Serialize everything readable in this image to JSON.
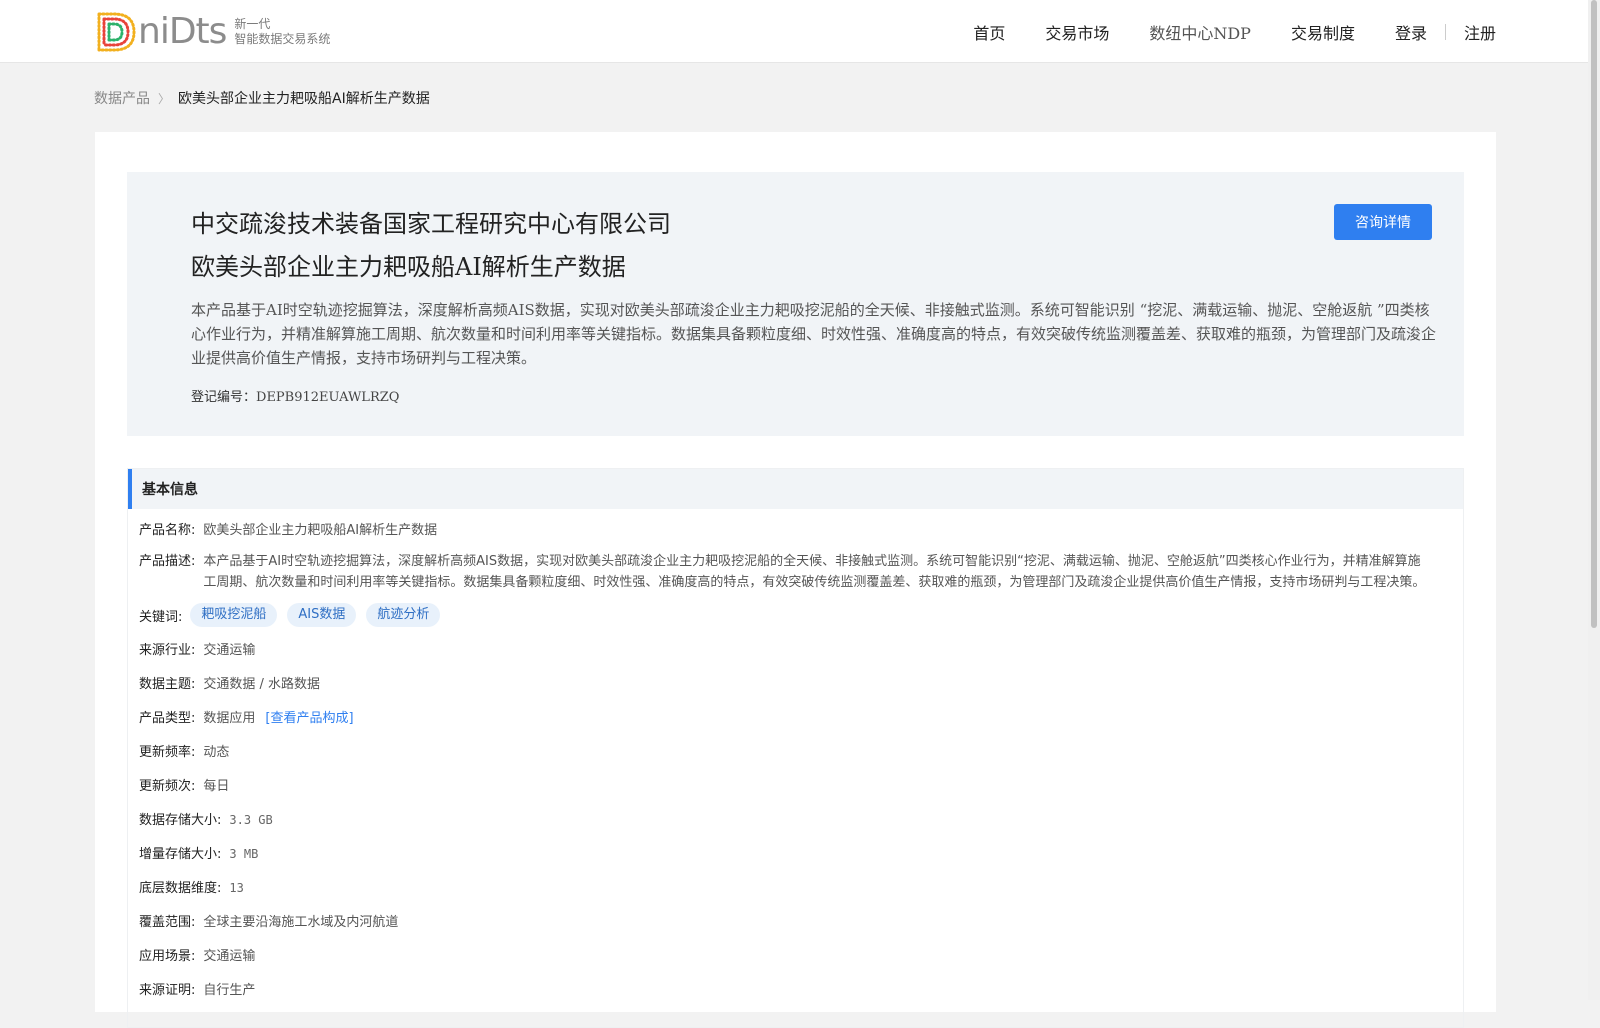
{
  "header": {
    "logo_word": "niDts",
    "logo_tag_line1": "新一代",
    "logo_tag_line2": "智能数据交易系统",
    "nav": [
      "首页",
      "交易市场",
      "数纽中心NDP",
      "交易制度"
    ],
    "login": "登录",
    "register": "注册"
  },
  "breadcrumb": {
    "parent": "数据产品",
    "current": "欧美头部企业主力耙吸船AI解析生产数据"
  },
  "hero": {
    "company": "中交疏浚技术装备国家工程研究中心有限公司",
    "title": "欧美头部企业主力耙吸船AI解析生产数据",
    "description": "本产品基于AI时空轨迹挖掘算法，深度解析高频AIS数据，实现对欧美头部疏浚企业主力耙吸挖泥船的全天候、非接触式监测。系统可智能识别 “挖泥、满载运输、抛泥、空舱返航 ”四类核心作业行为，并精准解算施工周期、航次数量和时间利用率等关键指标。数据集具备颗粒度细、时效性强、准确度高的特点，有效突破传统监测覆盖差、获取难的瓶颈，为管理部门及疏浚企业提供高价值生产情报，支持市场研判与工程决策。",
    "reg_label": "登记编号：",
    "reg_code": "DEPB912EUAWLRZQ",
    "consult_button": "咨询详情"
  },
  "basic_info": {
    "title": "基本信息",
    "product_name_label": "产品名称:",
    "product_name": "欧美头部企业主力耙吸船AI解析生产数据",
    "desc_label": "产品描述:",
    "desc": "本产品基于AI时空轨迹挖掘算法，深度解析高频AIS数据，实现对欧美头部疏浚企业主力耙吸挖泥船的全天候、非接触式监测。系统可智能识别“挖泥、满载运输、抛泥、空舱返航”四类核心作业行为，并精准解算施工周期、航次数量和时间利用率等关键指标。数据集具备颗粒度细、时效性强、准确度高的特点，有效突破传统监测覆盖差、获取难的瓶颈，为管理部门及疏浚企业提供高价值生产情报，支持市场研判与工程决策。",
    "keywords_label": "关键词:",
    "keywords": [
      "耙吸挖泥船",
      "AIS数据",
      "航迹分析"
    ],
    "industry_label": "来源行业:",
    "industry": "交通运输",
    "theme_label": "数据主题:",
    "theme": "交通数据 / 水路数据",
    "type_label": "产品类型:",
    "type": "数据应用",
    "type_link": "[查看产品构成]",
    "freq_label": "更新频率:",
    "freq": "动态",
    "cadence_label": "更新频次:",
    "cadence": "每日",
    "storage_label": "数据存储大小:",
    "storage": "3.3 GB",
    "inc_label": "增量存储大小:",
    "inc": "3 MB",
    "dim_label": "底层数据维度:",
    "dim": "13",
    "coverage_label": "覆盖范围:",
    "coverage": "全球主要沿海施工水域及内河航道",
    "scene_label": "应用场景:",
    "scene": "交通运输",
    "proof_label": "来源证明:",
    "proof": "自行生产"
  }
}
